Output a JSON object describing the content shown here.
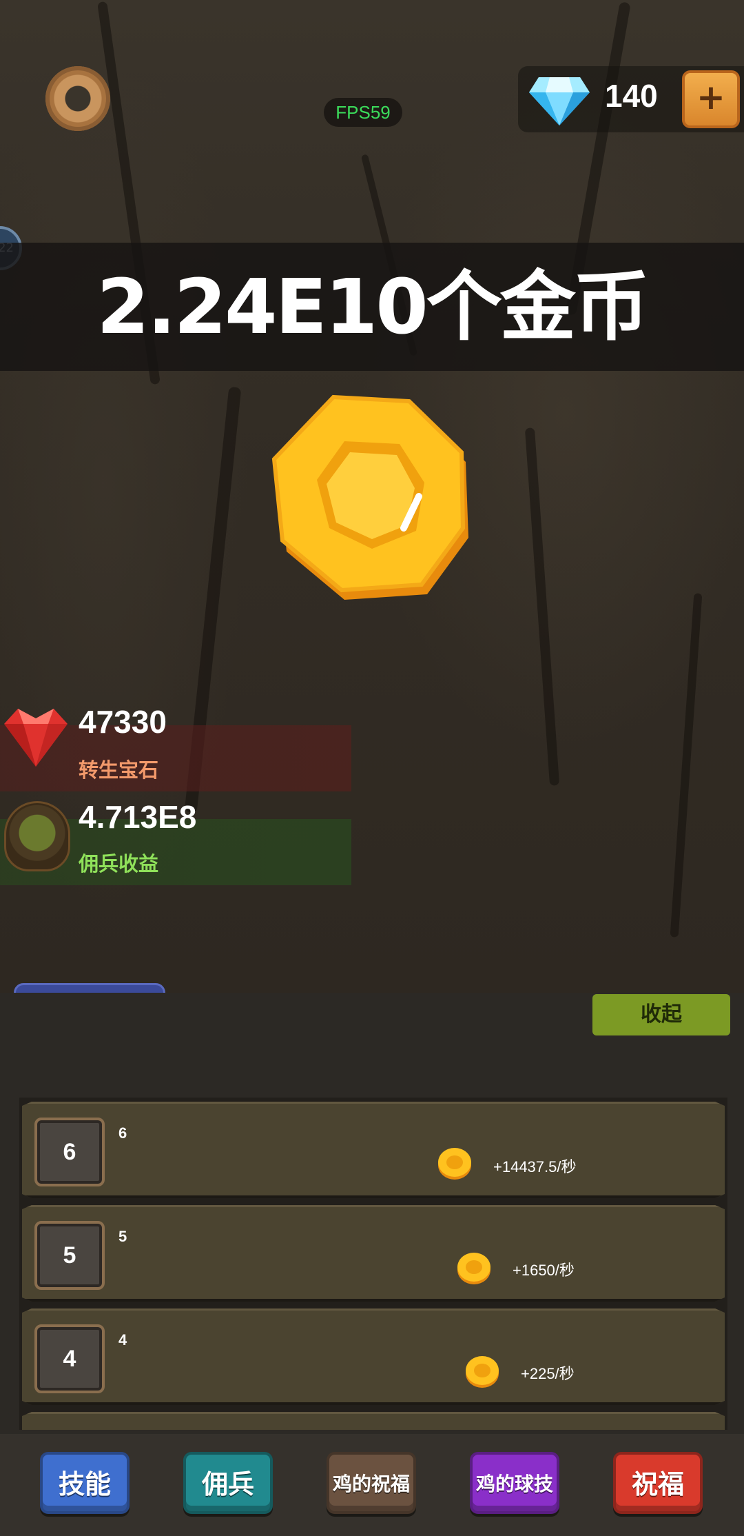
{
  "hud": {
    "fps_label": "FPS59",
    "gem_count": "140",
    "plus_label": "+",
    "side_badge": "22"
  },
  "banner": {
    "gold_text": "2.24E10个金币"
  },
  "stats": {
    "rebirth_gems_value": "47330",
    "rebirth_gems_label": "转生宝石",
    "merc_income_value": "4.713E8",
    "merc_income_label": "佣兵收益"
  },
  "panel": {
    "collapse_label": "收起",
    "rows": [
      {
        "icon_label": "6",
        "name": "6",
        "rate": "+14437.5/秒"
      },
      {
        "icon_label": "5",
        "name": "5",
        "rate": "+1650/秒"
      },
      {
        "icon_label": "4",
        "name": "4",
        "rate": "+225/秒"
      }
    ]
  },
  "nav": {
    "skills": "技能",
    "mercenary": "佣兵",
    "chicken_blessing": "鸡的祝福",
    "chicken_ball": "鸡的球技",
    "blessing": "祝福"
  },
  "colors": {
    "skills": "#3f6fcf",
    "mercenary": "#218a8f",
    "chicken_blessing": "#6b5240",
    "chicken_ball": "#8a2fc9",
    "blessing": "#d93a2c",
    "fps": "#3bdc5b",
    "collapse": "#7c9a24",
    "rebirth_label": "#f39a6b",
    "merc_label": "#8fe15a"
  }
}
